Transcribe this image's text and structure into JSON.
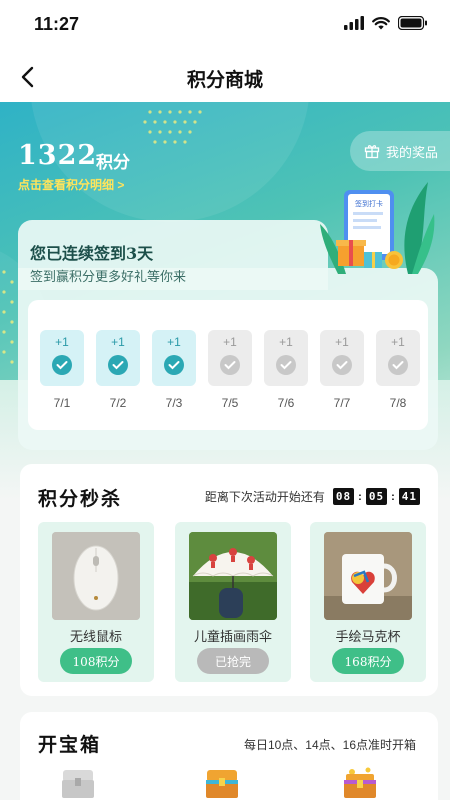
{
  "status_bar": {
    "time": "11:27"
  },
  "nav": {
    "title": "积分商城"
  },
  "points": {
    "value": "1322",
    "unit": "积分",
    "detail_link": "点击查看积分明细 >"
  },
  "my_prizes": {
    "label": "我的奖品"
  },
  "signin": {
    "title": "您已连续签到3天",
    "subtitle": "签到赢积分更多好礼等你来",
    "badge": "签到打卡",
    "days": [
      {
        "points": "+1",
        "date": "7/1",
        "checked": true
      },
      {
        "points": "+1",
        "date": "7/2",
        "checked": true
      },
      {
        "points": "+1",
        "date": "7/3",
        "checked": true
      },
      {
        "points": "+1",
        "date": "7/5",
        "checked": false
      },
      {
        "points": "+1",
        "date": "7/6",
        "checked": false
      },
      {
        "points": "+1",
        "date": "7/7",
        "checked": false
      },
      {
        "points": "+1",
        "date": "7/8",
        "checked": false
      }
    ]
  },
  "flash_sale": {
    "title": "积分秒杀",
    "countdown_label": "距离下次活动开始还有",
    "countdown": {
      "hours": "08",
      "minutes": "05",
      "seconds": "41"
    },
    "items": [
      {
        "name": "无线鼠标",
        "button": "108积分",
        "state": "available"
      },
      {
        "name": "儿童插画雨伞",
        "button": "已抢完",
        "state": "sold_out"
      },
      {
        "name": "手绘马克杯",
        "button": "168积分",
        "state": "available"
      }
    ]
  },
  "treasure": {
    "title": "开宝箱",
    "subtitle": "每日10点、14点、16点准时开箱"
  },
  "colors": {
    "accent": "#2ba8b4",
    "button_green": "#3fbf88",
    "link_yellow": "#ffe45c",
    "sold_out_gray": "#b9b9b9"
  }
}
